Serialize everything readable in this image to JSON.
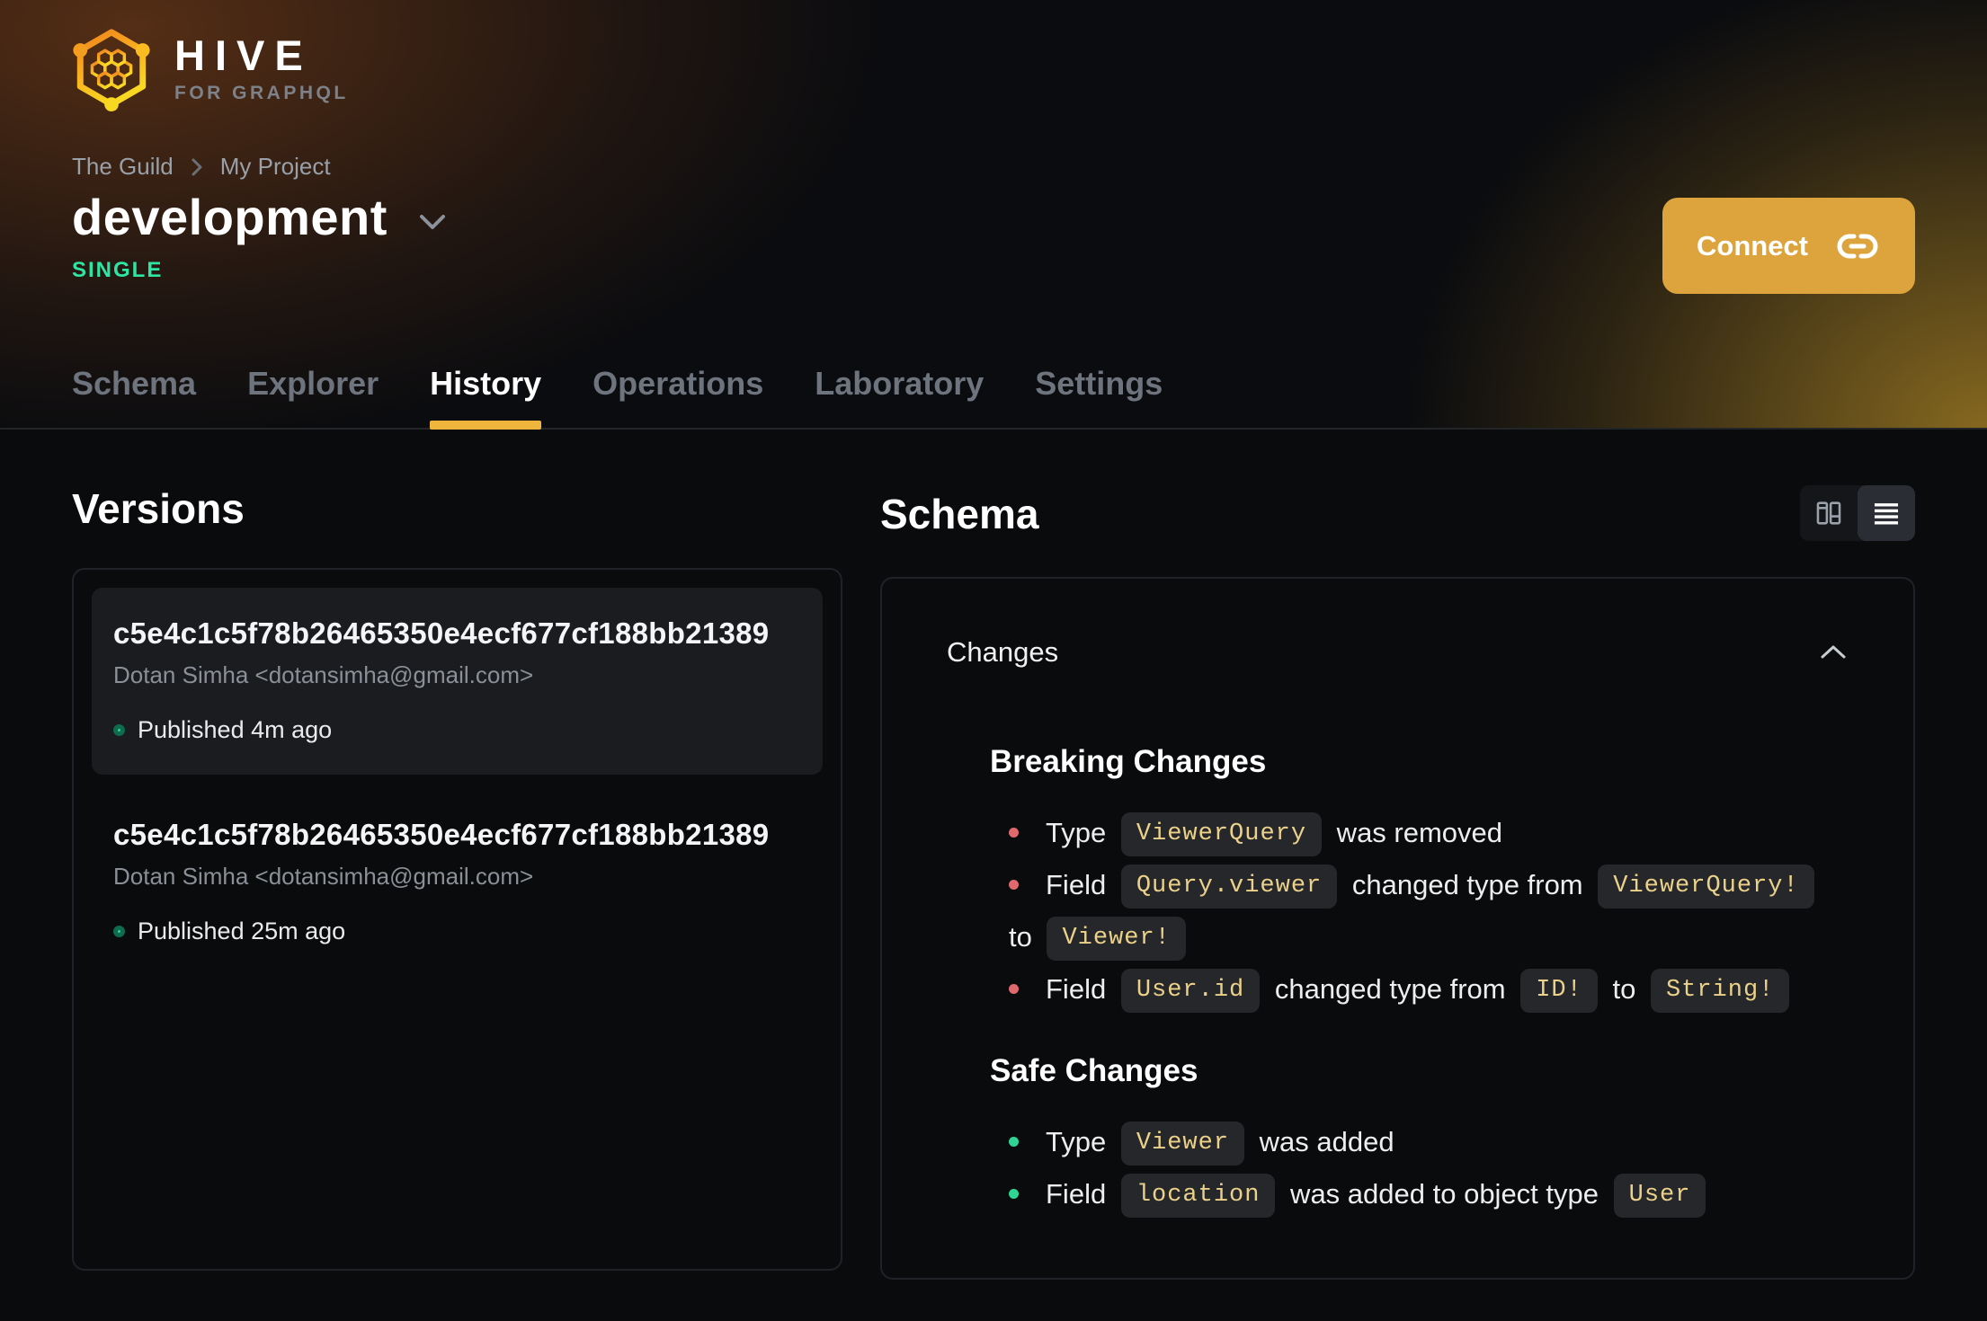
{
  "brand": {
    "name": "HIVE",
    "tagline": "FOR GRAPHQL"
  },
  "breadcrumb": {
    "org": "The Guild",
    "project": "My Project"
  },
  "target": {
    "name": "development",
    "badge": "SINGLE"
  },
  "actions": {
    "connect": "Connect"
  },
  "tabs": [
    {
      "label": "Schema",
      "active": false
    },
    {
      "label": "Explorer",
      "active": false
    },
    {
      "label": "History",
      "active": true
    },
    {
      "label": "Operations",
      "active": false
    },
    {
      "label": "Laboratory",
      "active": false
    },
    {
      "label": "Settings",
      "active": false
    }
  ],
  "versions": {
    "heading": "Versions",
    "items": [
      {
        "hash": "c5e4c1c5f78b26465350e4ecf677cf188bb21389",
        "author": "Dotan Simha <dotansimha@gmail.com>",
        "status": "Published 4m ago",
        "selected": true
      },
      {
        "hash": "c5e4c1c5f78b26465350e4ecf677cf188bb21389",
        "author": "Dotan Simha <dotansimha@gmail.com>",
        "status": "Published 25m ago",
        "selected": false
      }
    ]
  },
  "schema_view": {
    "heading": "Schema",
    "toggle": [
      {
        "icon": "split-view-icon",
        "active": false
      },
      {
        "icon": "list-view-icon",
        "active": true
      }
    ]
  },
  "changes": {
    "heading": "Changes",
    "sections": [
      {
        "title": "Breaking Changes",
        "kind": "breaking",
        "bullet_color": "#e0696e",
        "items": [
          [
            {
              "t": "text",
              "v": "Type "
            },
            {
              "t": "code",
              "v": "ViewerQuery"
            },
            {
              "t": "text",
              "v": " was removed"
            }
          ],
          [
            {
              "t": "text",
              "v": "Field "
            },
            {
              "t": "code",
              "v": "Query.viewer"
            },
            {
              "t": "text",
              "v": " changed type from "
            },
            {
              "t": "code",
              "v": "ViewerQuery!"
            },
            {
              "t": "nowrap",
              "parts": [
                {
                  "t": "text",
                  "v": " to "
                },
                {
                  "t": "code",
                  "v": "Viewer!"
                }
              ]
            }
          ],
          [
            {
              "t": "text",
              "v": "Field "
            },
            {
              "t": "code",
              "v": "User.id"
            },
            {
              "t": "text",
              "v": " changed type from "
            },
            {
              "t": "code",
              "v": "ID!"
            },
            {
              "t": "text",
              "v": " to "
            },
            {
              "t": "code",
              "v": "String!"
            }
          ]
        ]
      },
      {
        "title": "Safe Changes",
        "kind": "safe",
        "bullet_color": "#2fd495",
        "items": [
          [
            {
              "t": "text",
              "v": "Type "
            },
            {
              "t": "code",
              "v": "Viewer"
            },
            {
              "t": "text",
              "v": " was added"
            }
          ],
          [
            {
              "t": "text",
              "v": "Field "
            },
            {
              "t": "code",
              "v": "location"
            },
            {
              "t": "text",
              "v": " was added to object type "
            },
            {
              "t": "code",
              "v": "User"
            }
          ]
        ]
      }
    ]
  },
  "colors": {
    "accent_gold": "#eeb43c",
    "connect_button": "#dda43e",
    "badge_green": "#2ee5a4",
    "breaking_red": "#e0696e",
    "safe_green": "#2fd495",
    "chip_text": "#ebd189",
    "chip_bg": "#25272b"
  }
}
